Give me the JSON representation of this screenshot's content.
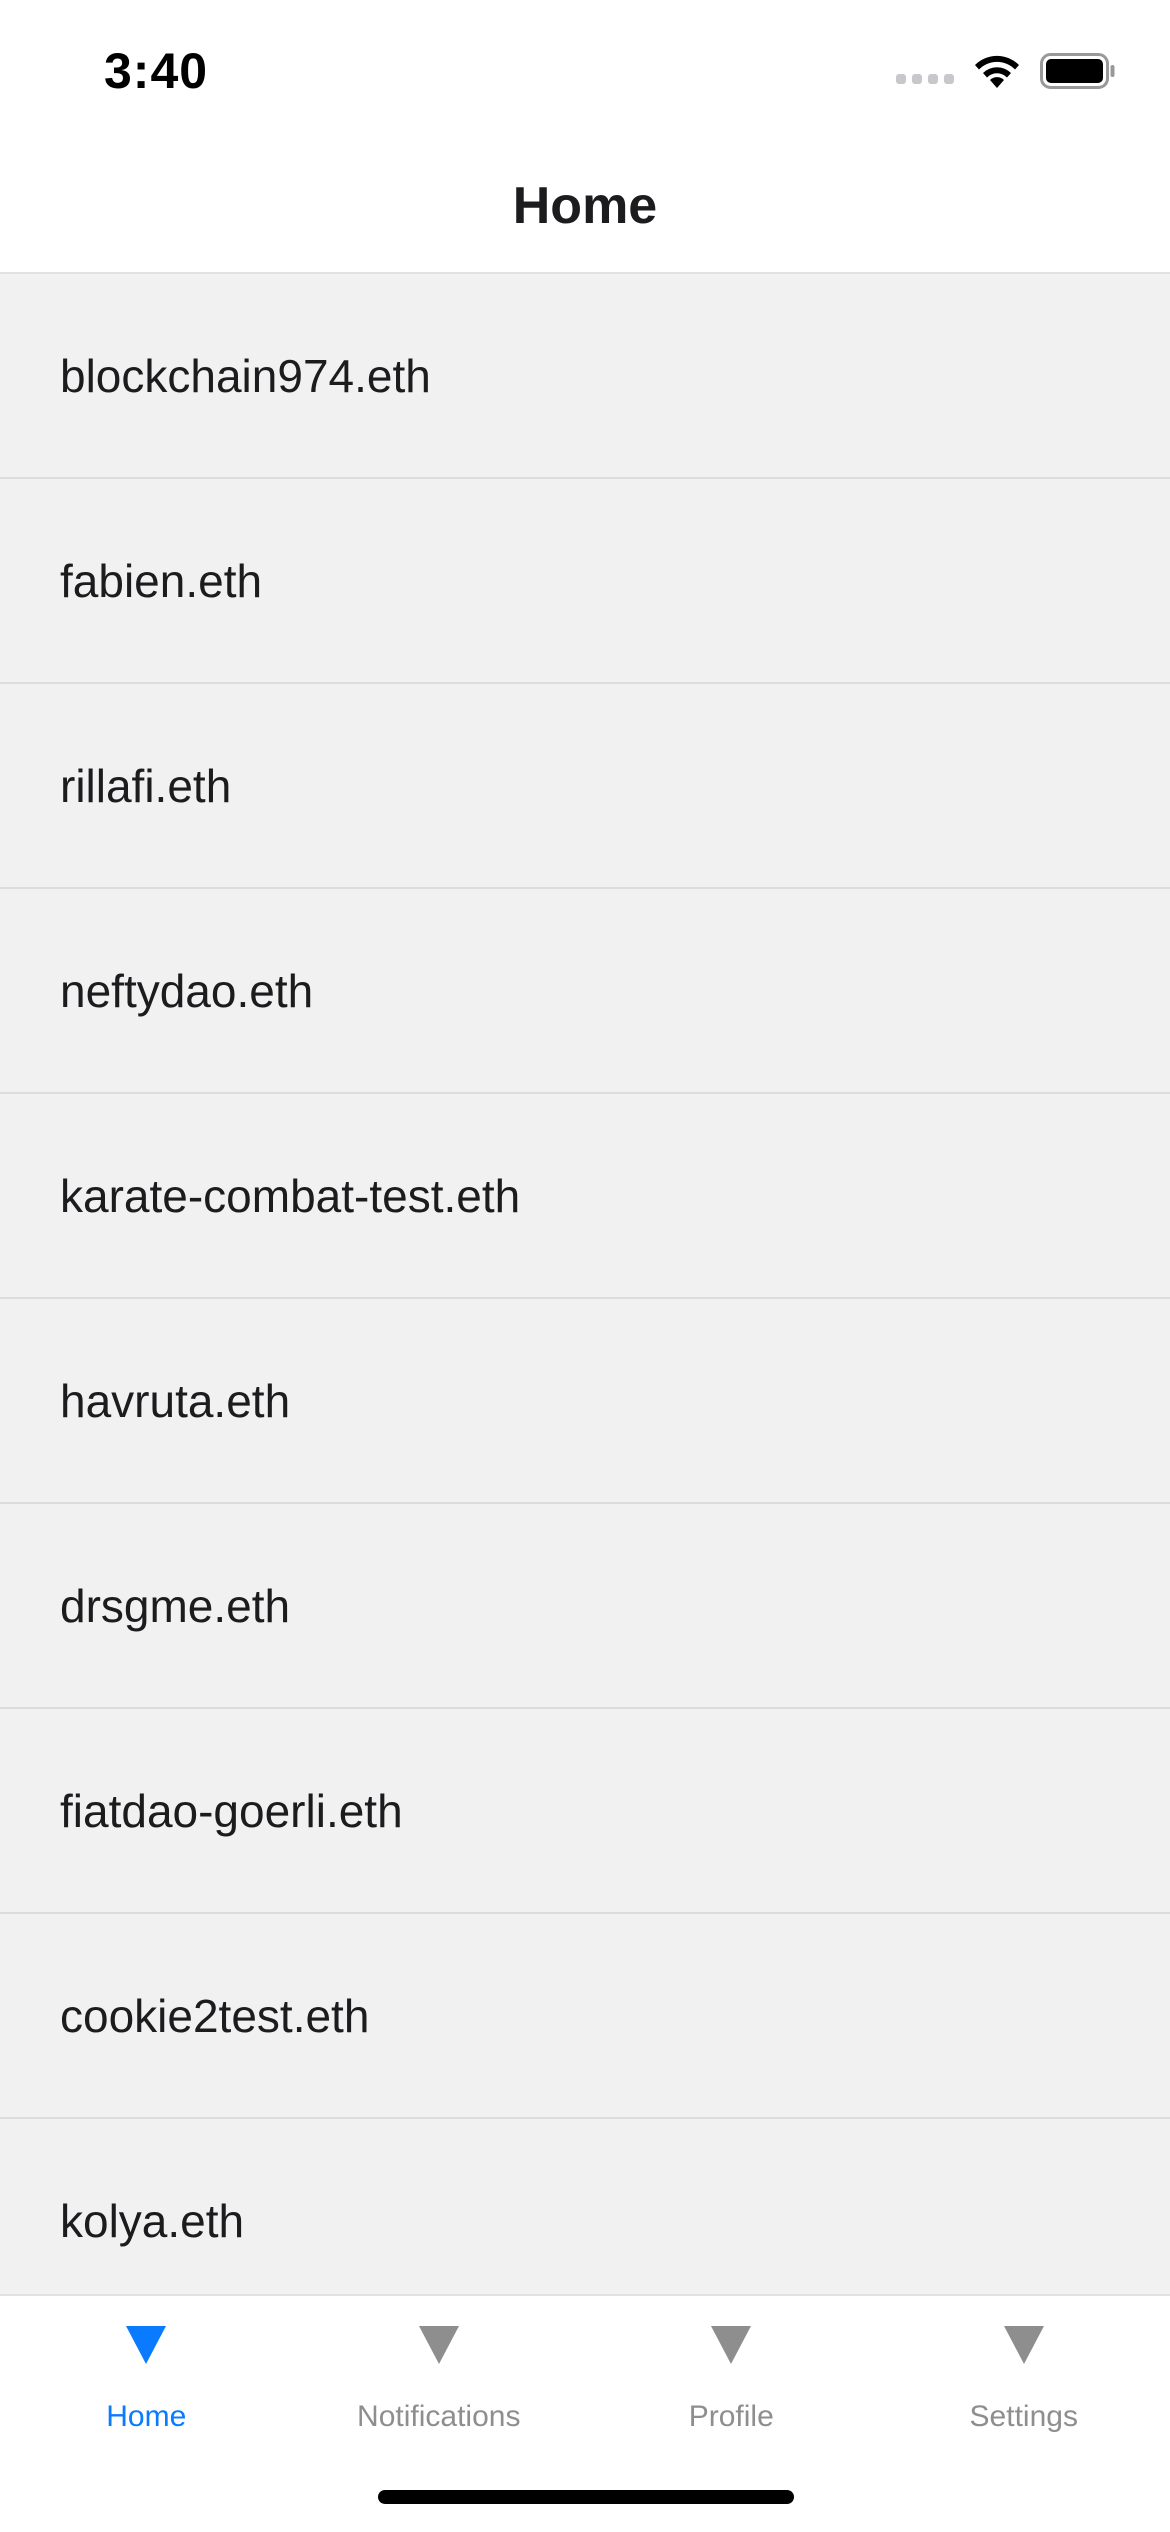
{
  "status_bar": {
    "time": "3:40",
    "icons": [
      "signal-dots-icon",
      "wifi-icon",
      "battery-icon"
    ]
  },
  "header": {
    "title": "Home"
  },
  "list": {
    "items": [
      {
        "label": "blockchain974.eth"
      },
      {
        "label": "fabien.eth"
      },
      {
        "label": "rillafi.eth"
      },
      {
        "label": "neftydao.eth"
      },
      {
        "label": "karate-combat-test.eth"
      },
      {
        "label": "havruta.eth"
      },
      {
        "label": "drsgme.eth"
      },
      {
        "label": "fiatdao-goerli.eth"
      },
      {
        "label": "cookie2test.eth"
      },
      {
        "label": "kolya.eth"
      }
    ]
  },
  "tab_bar": {
    "tabs": [
      {
        "label": "Home",
        "icon": "triangle-down-icon",
        "active": true
      },
      {
        "label": "Notifications",
        "icon": "triangle-down-icon",
        "active": false
      },
      {
        "label": "Profile",
        "icon": "triangle-down-icon",
        "active": false
      },
      {
        "label": "Settings",
        "icon": "triangle-down-icon",
        "active": false
      }
    ]
  },
  "colors": {
    "accent": "#0a7aff",
    "inactive": "#8e8e8e",
    "list_background": "#f1f1f1",
    "text": "#1c1c1e"
  }
}
